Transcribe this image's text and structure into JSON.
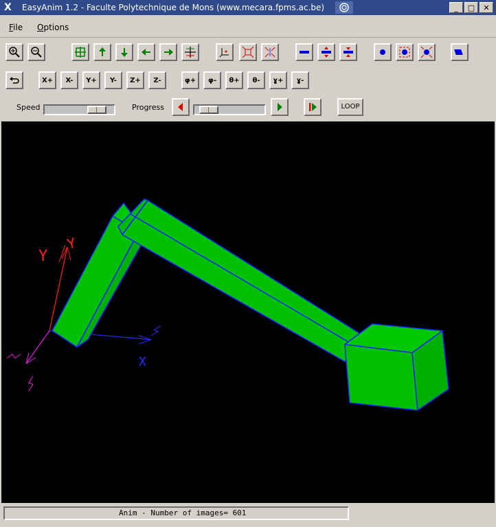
{
  "window": {
    "title": "EasyAnim 1.2 - Faculte Polytechnique de Mons (www.mecara.fpms.ac.be)",
    "app_icon_glyph": "X",
    "btn_minimize": "_",
    "btn_maximize": "□",
    "btn_close": "✕"
  },
  "menu": {
    "file_hot": "F",
    "file_rest": "ile",
    "options_hot": "O",
    "options_rest": "ptions"
  },
  "toolbar2": {
    "x_plus": "X+",
    "x_minus": "X-",
    "y_plus": "Y+",
    "y_minus": "Y-",
    "z_plus": "Z+",
    "z_minus": "Z-",
    "phi_plus": "φ+",
    "phi_minus": "φ-",
    "theta_plus": "θ+",
    "theta_minus": "θ-",
    "gamma_plus": "ɣ+",
    "gamma_minus": "ɣ-"
  },
  "playback": {
    "speed_label": "Speed",
    "progress_label": "Progress",
    "loop_label": "LOOP",
    "speed_value": 0.85,
    "progress_value": 0.1
  },
  "scene": {
    "axis_y_left": "Y",
    "axis_y_right": "Y",
    "axis_x": "X",
    "body_color": "#00c000",
    "edge_color": "#2020ff",
    "axis_red": "#ff2020",
    "axis_blue": "#2a2aff",
    "axis_magenta": "#e020e0"
  },
  "status": {
    "text": "Anim - Number of images= 601"
  },
  "icons": [
    "zoom-in-icon",
    "zoom-out-icon",
    "pan-icon",
    "arrow-up-icon",
    "arrow-down-icon",
    "arrow-left-icon",
    "arrow-right-icon",
    "center-icon",
    "axes-icon",
    "fit-view-icon",
    "shrink-view-icon",
    "line-icon",
    "line-expand-icon",
    "line-shrink-icon",
    "point-icon",
    "point-expand-icon",
    "point-shrink-icon",
    "shading-icon",
    "undo-icon",
    "play-back-icon",
    "play-forward-icon",
    "step-forward-icon"
  ]
}
